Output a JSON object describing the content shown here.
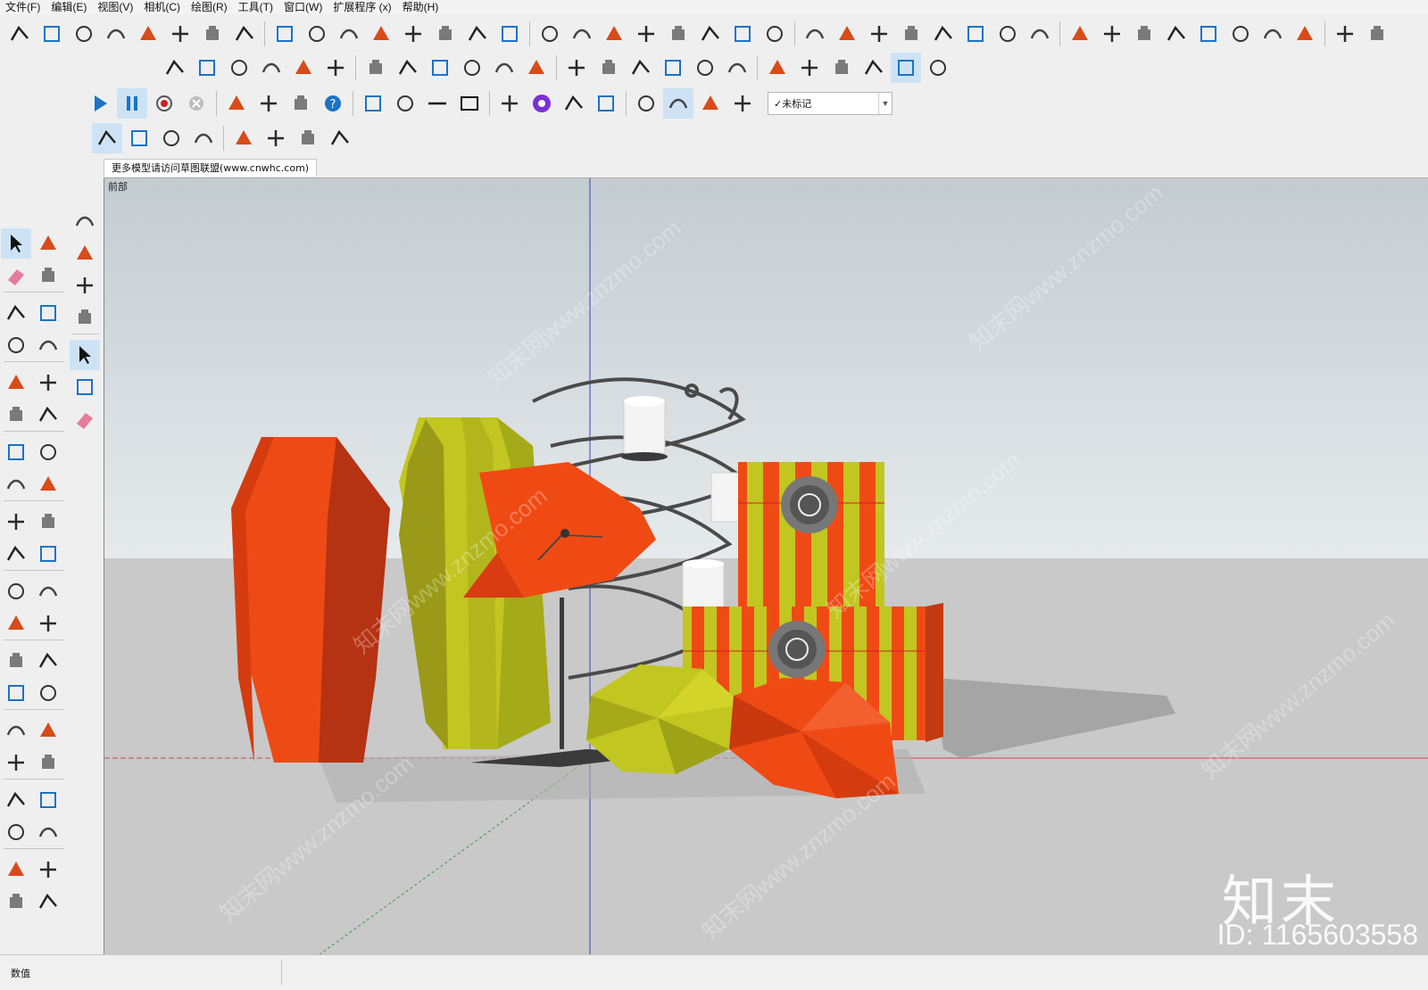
{
  "menu": [
    "文件(F)",
    "编辑(E)",
    "视图(V)",
    "相机(C)",
    "绘图(R)",
    "工具(T)",
    "窗口(W)",
    "扩展程序 (x)",
    "帮助(H)"
  ],
  "tag_select": {
    "value": "未标记",
    "check": "✓"
  },
  "scene_tab": "更多模型请访问草图联盟(www.cnwhc.com)",
  "view_label": "前部",
  "status": {
    "label": "数值"
  },
  "watermark": {
    "logo": "知末",
    "id": "ID: 1165603558",
    "diagonal": "知末网www.znzmo.com"
  },
  "colors": {
    "accent_blue": "#1a73c9",
    "orange": "#f04a14",
    "olive": "#c2c620",
    "sky": "#c9d3d8",
    "ground": "#c8c9c9"
  },
  "toolbar_row1_icons": [
    "large-tool-icon",
    "rectangle-ruler-icon",
    "dimension-line-icon",
    "bar-chart-icon",
    "layers-stack-icon",
    "line-divider-icon",
    "curve-path-icon",
    "wave-pen-icon",
    "arch-icon",
    "arc-rotate-icon",
    "dimension-cross-icon",
    "flat-bar-icon",
    "ring-icon",
    "pipe-icon",
    "surface-icon",
    "solid-icon",
    "cut-icon",
    "dome-icon",
    "dash-chain-icon",
    "smooth-curve-icon",
    "spiral-icon",
    "flag-icon",
    "columns-icon",
    "comb-icon",
    "mirror-icon",
    "grid-dots-icon",
    "book-icon",
    "pen-tool-icon",
    "brush-icon",
    "film-icon",
    "target-icon",
    "folder-up-icon",
    "checkbox-icon",
    "cloud-icon",
    "cube-outline-icon",
    "refresh-icon",
    "house-3d-icon",
    "cabinet-icon",
    "home-icon",
    "shop-icon",
    "house-outline-icon",
    "box-open-icon"
  ],
  "toolbar_row2_icons": [
    "knife-icon",
    "ruler-icon",
    "sweep-icon",
    "pencil-slab-icon",
    "box-orange-icon",
    "cylinder-icon",
    "face-blue-icon",
    "extrude-icon",
    "x-cut-icon",
    "ribbon-icon",
    "scale-in-icon",
    "scale-out-icon",
    "stack-a-icon",
    "stack-b-icon",
    "stack-c-icon",
    "stack-d-icon",
    "stack-e-icon",
    "stack-f-icon",
    "cube-wire-icon",
    "cube-iso-icon",
    "cube-flat-icon",
    "cube-shaded-icon",
    "cube-mono-icon",
    "cube-blue-icon"
  ],
  "toolbar_row3_icons": [
    "play-icon",
    "pause-icon",
    "record-icon",
    "stop-icon",
    "gear-icon",
    "film-strip-icon",
    "film-disabled-icon",
    "help-icon",
    "dot-icon",
    "cone-icon",
    "line-icon",
    "rectangle-icon",
    "hidden-eye-icon",
    "purple-logo-icon",
    "spinner-icon",
    "camera-move-icon",
    "camera-icon",
    "clock-icon",
    "flower-icon",
    "box-tag-icon"
  ],
  "toolbar_row4_icons": [
    "cloud-wave-icon",
    "cloud-share-icon",
    "cloud-check-icon",
    "cloud-list-icon",
    "frame-icon",
    "network-icon",
    "refresh-check-icon",
    "chrome-icon"
  ],
  "left_tools": [
    "select-icon",
    "component-icon",
    "eraser-icon",
    "paint-icon",
    "pencil-icon",
    "freehand-icon",
    "rectangle-tool-icon",
    "rotated-rect-icon",
    "circle-icon",
    "polygon-icon",
    "arc-icon",
    "two-point-arc-icon",
    "three-point-arc-icon",
    "pie-icon",
    "move-icon",
    "push-pull-icon",
    "rotate-icon",
    "follow-me-icon",
    "scale-icon",
    "offset-icon",
    "tape-measure-icon",
    "dimension-tool-icon",
    "protractor-icon",
    "text-icon",
    "axes-icon",
    "3d-text-icon",
    "orbit-icon",
    "pan-icon",
    "zoom-icon",
    "zoom-window-icon",
    "zoom-extents-icon",
    "previous-view-icon",
    "position-camera-icon",
    "look-around-icon",
    "walk-icon",
    "section-plane-icon",
    "sandbox-from-contours-icon",
    "sandbox-from-scratch-icon",
    "smoove-icon",
    "stamp-icon"
  ],
  "left_tools2": [
    "download-icon",
    "warehouse-icon",
    "extension-warehouse-icon",
    "settings-cog-icon",
    "pointer-icon",
    "component-alt-icon",
    "eraser-alt-icon"
  ]
}
